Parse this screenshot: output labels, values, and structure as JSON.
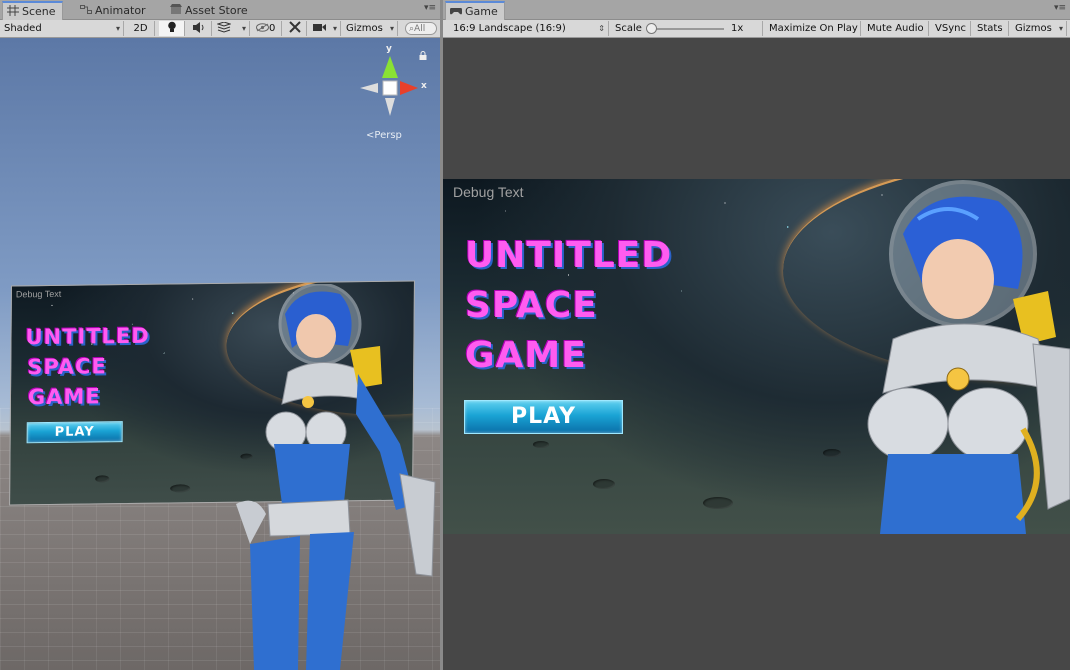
{
  "scene": {
    "tabs": [
      {
        "label": "Scene",
        "icon": "grid-icon",
        "active": true
      },
      {
        "label": "Animator",
        "icon": "animator-icon",
        "active": false
      },
      {
        "label": "Asset Store",
        "icon": "store-icon",
        "active": false
      }
    ],
    "toolbar": {
      "shading_mode": "Shaded",
      "mode_2d": "2D",
      "hidden_count": "0",
      "gizmos": "Gizmos",
      "search_placeholder": "All"
    },
    "gizmo": {
      "y_label": "y",
      "x_label": "x",
      "persp_label": "Persp"
    },
    "game_canvas": {
      "debug_text": "Debug Text",
      "title_lines": [
        "UNTITLED",
        "SPACE",
        "GAME"
      ],
      "play_label": "PLAY"
    }
  },
  "game": {
    "tab": {
      "label": "Game",
      "icon": "gamepad-icon"
    },
    "toolbar": {
      "aspect": "16:9 Landscape (16:9)",
      "scale_label": "Scale",
      "scale_value": "1x",
      "scale_fraction": 0.0,
      "maximize_on_play": "Maximize On Play",
      "mute_audio": "Mute Audio",
      "vsync": "VSync",
      "stats": "Stats",
      "gizmos": "Gizmos"
    },
    "canvas": {
      "debug_text": "Debug Text",
      "title_lines": [
        "UNTITLED",
        "SPACE",
        "GAME"
      ],
      "play_label": "PLAY"
    }
  },
  "colors": {
    "title_pink": "#ff5cf0",
    "title_shadow": "#2a62c9",
    "play_cyan": "#1aa3d4",
    "tab_accent": "#5b8ad8"
  }
}
